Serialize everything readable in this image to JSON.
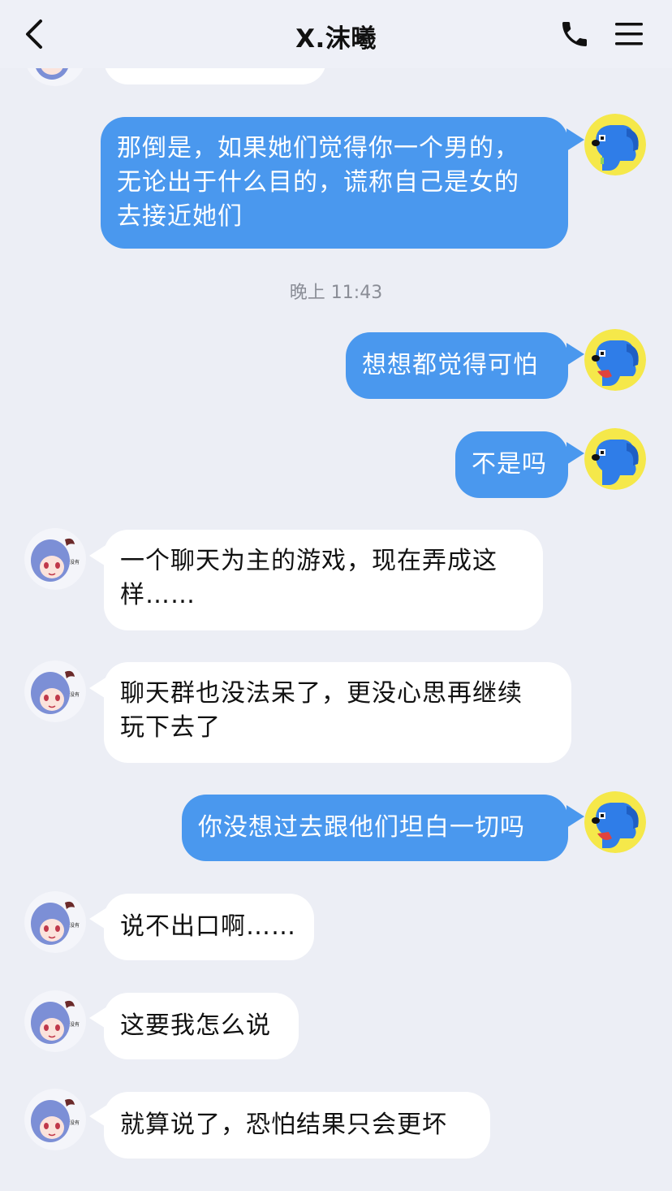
{
  "header": {
    "title": "X.沫曦",
    "back_icon": "chevron-left-icon",
    "call_icon": "phone-icon",
    "menu_icon": "hamburger-menu-icon"
  },
  "timestamp": "晚上 11:43",
  "colors": {
    "outgoing_bubble": "#4a98ee",
    "incoming_bubble": "#ffffff",
    "background": "#eceef5"
  },
  "messages": [
    {
      "dir": "out",
      "text_lines": [
        "那倒是，如果她们觉得你一个男的，",
        "无论出于什么目的，谎称自己是女的",
        "去接近她们"
      ]
    },
    {
      "dir": "out",
      "text": "想想都觉得可怕"
    },
    {
      "dir": "out",
      "text": "不是吗"
    },
    {
      "dir": "in",
      "text_lines": [
        "一个聊天为主的游戏，现在弄成这",
        "样……"
      ]
    },
    {
      "dir": "in",
      "text_lines": [
        "聊天群也没法呆了，更没心思再继续",
        "玩下去了"
      ]
    },
    {
      "dir": "out",
      "text": "你没想过去跟他们坦白一切吗"
    },
    {
      "dir": "in",
      "text": "说不出口啊……"
    },
    {
      "dir": "in",
      "text": "这要我怎么说"
    },
    {
      "dir": "in",
      "text": "就算说了，恐怕结果只会更坏"
    }
  ]
}
